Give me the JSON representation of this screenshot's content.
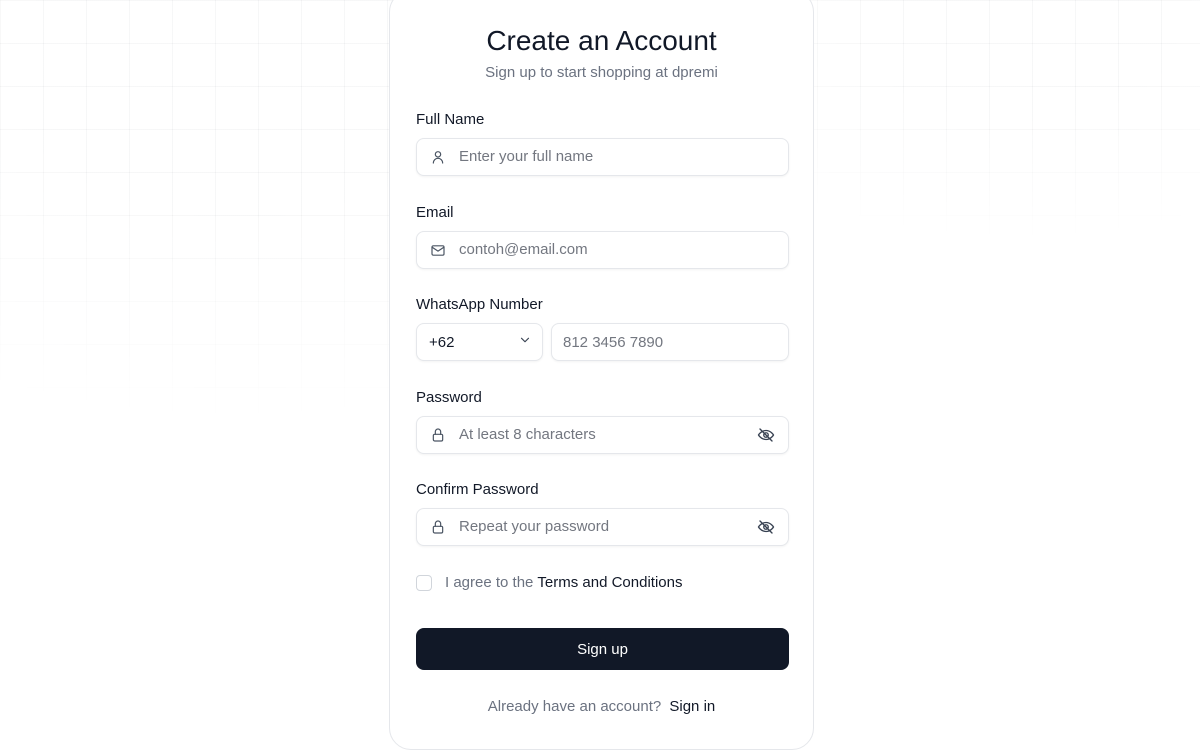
{
  "header": {
    "title": "Create an Account",
    "subtitle": "Sign up to start shopping at dpremi"
  },
  "form": {
    "full_name": {
      "label": "Full Name",
      "placeholder": "Enter your full name",
      "icon": "user-icon"
    },
    "email": {
      "label": "Email",
      "placeholder": "contoh@email.com",
      "icon": "mail-icon"
    },
    "whatsapp": {
      "label": "WhatsApp Number",
      "country_code": "+62",
      "placeholder": "812 3456 7890"
    },
    "password": {
      "label": "Password",
      "placeholder": "At least 8 characters",
      "icon": "lock-icon",
      "toggle_icon": "eye-off-icon"
    },
    "confirm_password": {
      "label": "Confirm Password",
      "placeholder": "Repeat your password",
      "icon": "lock-icon",
      "toggle_icon": "eye-off-icon"
    },
    "terms": {
      "prefix": "I agree to the",
      "link": "Terms and Conditions",
      "checked": false
    },
    "submit_label": "Sign up"
  },
  "footer": {
    "prompt": "Already have an account?",
    "link": "Sign in"
  },
  "colors": {
    "primary_button": "#111827",
    "muted_text": "#6b7280",
    "border": "#e5e7eb"
  }
}
